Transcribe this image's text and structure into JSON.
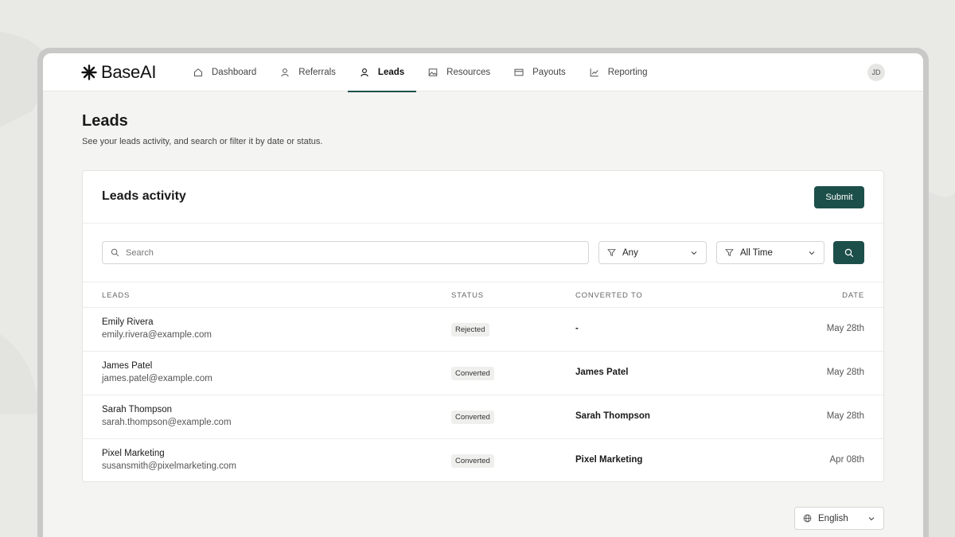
{
  "app": {
    "brand": "BaseAI",
    "user_initials": "JD",
    "accent_color": "#1d4f4a"
  },
  "nav": {
    "items": [
      {
        "label": "Dashboard",
        "icon": "home-icon",
        "active": false
      },
      {
        "label": "Referrals",
        "icon": "user-icon",
        "active": false
      },
      {
        "label": "Leads",
        "icon": "user-icon",
        "active": true
      },
      {
        "label": "Resources",
        "icon": "image-icon",
        "active": false
      },
      {
        "label": "Payouts",
        "icon": "card-icon",
        "active": false
      },
      {
        "label": "Reporting",
        "icon": "chart-line-icon",
        "active": false
      }
    ]
  },
  "page": {
    "title": "Leads",
    "subtitle": "See your leads activity, and search or filter it by date or status."
  },
  "card": {
    "title": "Leads activity",
    "submit_label": "Submit",
    "search_placeholder": "Search",
    "status_filter": "Any",
    "time_filter": "All Time",
    "columns": [
      "LEADS",
      "STATUS",
      "CONVERTED TO",
      "DATE"
    ],
    "rows": [
      {
        "name": "Emily Rivera",
        "email": "emily.rivera@example.com",
        "status": "Rejected",
        "converted_to": "-",
        "date": "May 28th"
      },
      {
        "name": "James Patel",
        "email": "james.patel@example.com",
        "status": "Converted",
        "converted_to": "James Patel",
        "date": "May 28th"
      },
      {
        "name": "Sarah Thompson",
        "email": "sarah.thompson@example.com",
        "status": "Converted",
        "converted_to": "Sarah Thompson",
        "date": "May 28th"
      },
      {
        "name": "Pixel Marketing",
        "email": "susansmith@pixelmarketing.com",
        "status": "Converted",
        "converted_to": "Pixel Marketing",
        "date": "Apr 08th"
      }
    ]
  },
  "footer": {
    "language": "English"
  }
}
